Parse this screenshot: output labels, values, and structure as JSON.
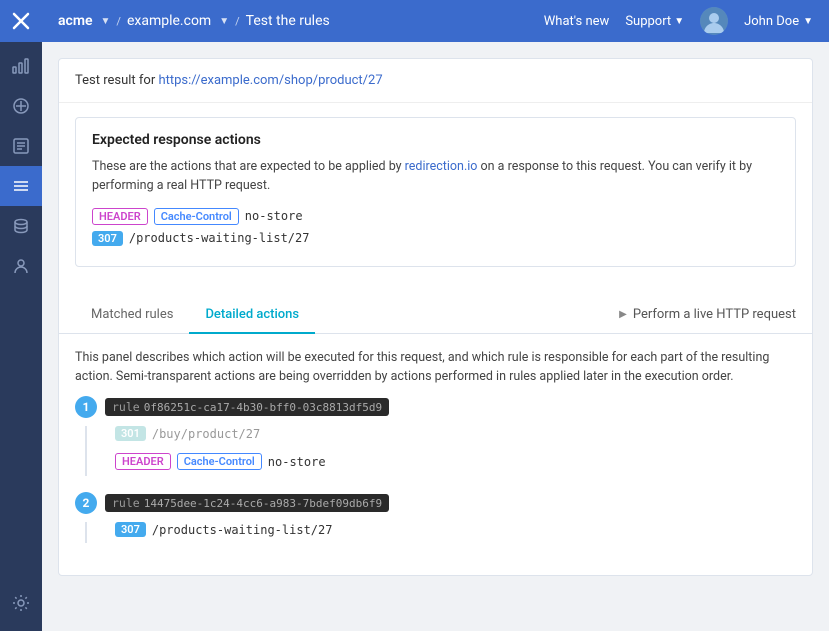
{
  "sidebar": {
    "icons": [
      {
        "name": "logo",
        "symbol": "✕"
      },
      {
        "name": "chart-icon",
        "symbol": "📊"
      },
      {
        "name": "target-icon",
        "symbol": "🎯"
      },
      {
        "name": "list-icon",
        "symbol": "☰"
      },
      {
        "name": "rules-icon",
        "symbol": "≡"
      },
      {
        "name": "database-icon",
        "symbol": "🗄"
      },
      {
        "name": "person-icon",
        "symbol": "👤"
      },
      {
        "name": "gear-icon",
        "symbol": "⚙"
      }
    ]
  },
  "topnav": {
    "org": "acme",
    "site": "example.com",
    "page": "Test the rules",
    "whats_new": "What's new",
    "support": "Support",
    "user": "John Doe"
  },
  "test_result": {
    "label": "Test result for ",
    "url": "https://example.com/shop/product/27"
  },
  "expected_response": {
    "title": "Expected response actions",
    "description": "These are the actions that are expected to be applied by redirection.io on a response to this request. You can verify it by performing a real HTTP request.",
    "actions": [
      {
        "type": "header",
        "label1": "HEADER",
        "label2": "Cache-Control",
        "value": "no-store"
      },
      {
        "type": "redirect",
        "label": "307",
        "value": "/products-waiting-list/27"
      }
    ]
  },
  "tabs": {
    "matched_rules": "Matched rules",
    "detailed_actions": "Detailed actions",
    "perform_live": "Perform a live HTTP request"
  },
  "panel": {
    "description": "This panel describes which action will be executed for this request, and which rule is responsible for each part of the resulting action. Semi-transparent actions are being overridden by actions performed in rules applied later in the execution order."
  },
  "rules": [
    {
      "number": "1",
      "uuid": "0f86251c-ca17-4b30-bff0-03c8813df5d9",
      "actions": [
        {
          "type": "301",
          "value": "/buy/product/27"
        },
        {
          "type": "header",
          "label2": "Cache-Control",
          "value": "no-store"
        }
      ]
    },
    {
      "number": "2",
      "uuid": "14475dee-1c24-4cc6-a983-7bdef09db6f9",
      "actions": [
        {
          "type": "307",
          "value": "/products-waiting-list/27"
        }
      ]
    }
  ]
}
